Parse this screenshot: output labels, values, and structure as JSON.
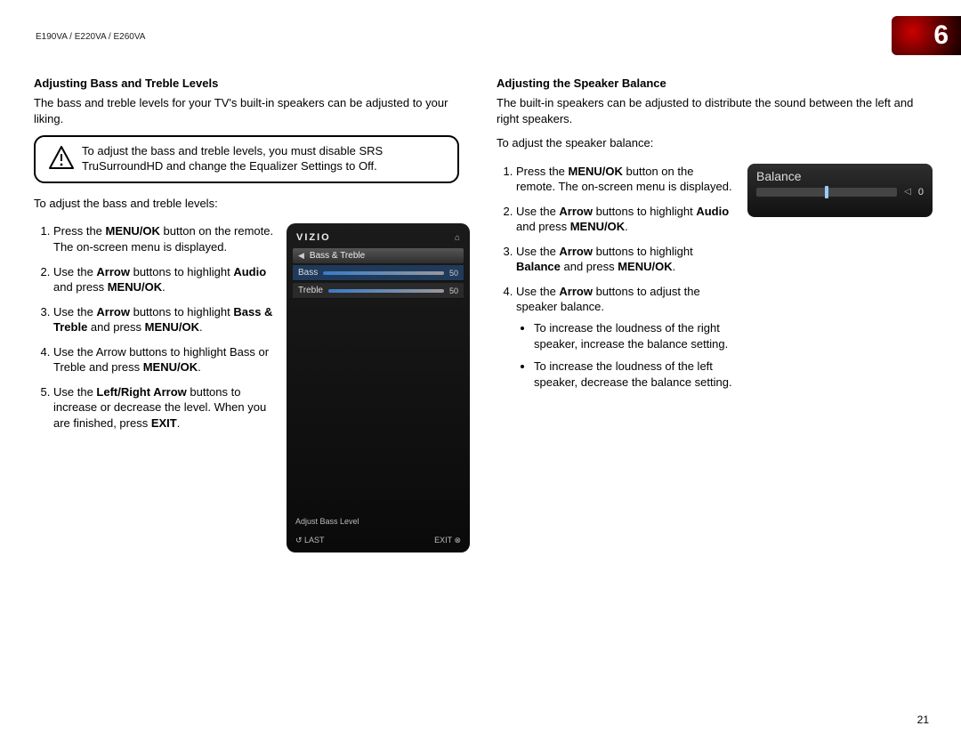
{
  "header": {
    "model_line": "E190VA / E220VA / E260VA",
    "chapter_number": "6",
    "page_number": "21"
  },
  "left": {
    "heading": "Adjusting Bass and Treble Levels",
    "intro": "The bass and treble levels for your TV's built-in speakers can be adjusted to your liking.",
    "callout": "To adjust the bass and treble levels, you must disable SRS TruSurroundHD and change the Equalizer Settings to Off.",
    "lead": "To adjust the bass and treble levels:",
    "steps": {
      "s1a": "Press the ",
      "s1b": "MENU/OK",
      "s1c": " button on the remote. The on-screen menu is displayed.",
      "s2a": "Use the ",
      "s2b": "Arrow",
      "s2c": " buttons to highlight ",
      "s2d": "Audio",
      "s2e": " and press ",
      "s2f": "MENU/OK",
      "s2g": ".",
      "s3a": "Use the ",
      "s3b": "Arrow",
      "s3c": " buttons to highlight ",
      "s3d": "Bass & Treble",
      "s3e": " and press ",
      "s3f": "MENU/OK",
      "s3g": ".",
      "s4a": "Use the Arrow buttons to highlight Bass or Treble and press ",
      "s4b": "MENU/OK",
      "s4c": ".",
      "s5a": "Use the ",
      "s5b": "Left/Right Arrow",
      "s5c": " buttons to increase or decrease the level. When you are finished, press ",
      "s5d": "EXIT",
      "s5e": "."
    },
    "figure": {
      "brand": "VIZIO",
      "title": "Bass & Treble",
      "rows": [
        {
          "label": "Bass",
          "value": "50"
        },
        {
          "label": "Treble",
          "value": "50"
        }
      ],
      "helper": "Adjust Bass Level",
      "footer_left": "↺ LAST",
      "footer_right": "EXIT ⊗",
      "home_icon": "⌂"
    }
  },
  "right": {
    "heading": "Adjusting the Speaker Balance",
    "intro": "The built-in speakers can be adjusted to distribute the sound between the left and right speakers.",
    "lead": "To adjust the speaker balance:",
    "steps": {
      "s1a": "Press the ",
      "s1b": "MENU/OK",
      "s1c": " button on the remote. The on-screen menu is displayed.",
      "s2a": "Use the ",
      "s2b": "Arrow",
      "s2c": " buttons to highlight ",
      "s2d": "Audio",
      "s2e": " and press ",
      "s2f": "MENU/OK",
      "s2g": ".",
      "s3a": "Use the ",
      "s3b": "Arrow",
      "s3c": " buttons to highlight ",
      "s3d": "Balance",
      "s3e": " and press ",
      "s3f": "MENU/OK",
      "s3g": ".",
      "s4a": "Use the ",
      "s4b": "Arrow",
      "s4c": " buttons to adjust the speaker balance.",
      "b1": "To increase the loudness of the right speaker, increase the balance setting.",
      "b2": "To increase the loudness of the left speaker, decrease the balance setting."
    },
    "figure": {
      "title": "Balance",
      "value": "0",
      "arrow": "◁"
    }
  }
}
